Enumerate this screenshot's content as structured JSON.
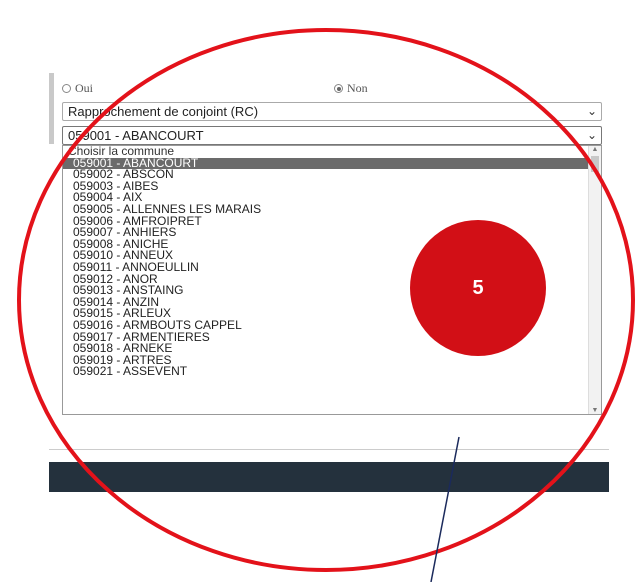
{
  "radio": {
    "oui_label": "Oui",
    "non_label": "Non",
    "selected": "Non"
  },
  "motif_select": {
    "value": "Rapprochement de conjoint (RC)"
  },
  "commune_select": {
    "value": "059001 - ABANCOURT"
  },
  "dropdown": {
    "placeholder": "Choisir la commune",
    "options": [
      "059001 - ABANCOURT",
      "059002 - ABSCON",
      "059003 - AIBES",
      "059004 - AIX",
      "059005 - ALLENNES LES MARAIS",
      "059006 - AMFROIPRET",
      "059007 - ANHIERS",
      "059008 - ANICHE",
      "059010 - ANNEUX",
      "059011 - ANNOEULLIN",
      "059012 - ANOR",
      "059013 - ANSTAING",
      "059014 - ANZIN",
      "059015 - ARLEUX",
      "059016 - ARMBOUTS CAPPEL",
      "059017 - ARMENTIERES",
      "059018 - ARNEKE",
      "059019 - ARTRES",
      "059021 - ASSEVENT"
    ],
    "selected_index": 0
  },
  "annotation": {
    "number": "5",
    "color": "#d20f16"
  },
  "colors": {
    "dark_bar": "#24313d",
    "selected_option": "#6b6b6b"
  }
}
